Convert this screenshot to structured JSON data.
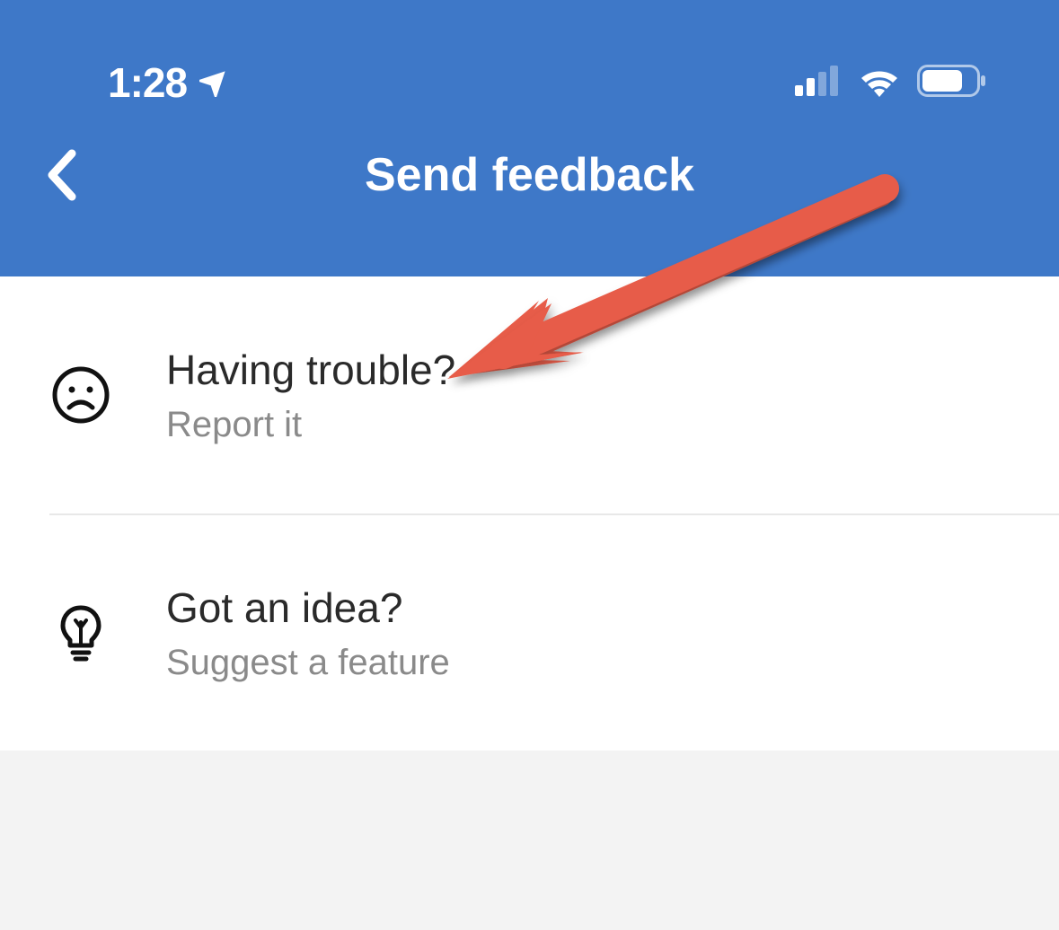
{
  "status_bar": {
    "time": "1:28"
  },
  "header": {
    "title": "Send feedback"
  },
  "items": [
    {
      "title": "Having trouble?",
      "subtitle": "Report it"
    },
    {
      "title": "Got an idea?",
      "subtitle": "Suggest a feature"
    }
  ],
  "colors": {
    "header_bg": "#3e78c8",
    "arrow": "#e75c48"
  }
}
